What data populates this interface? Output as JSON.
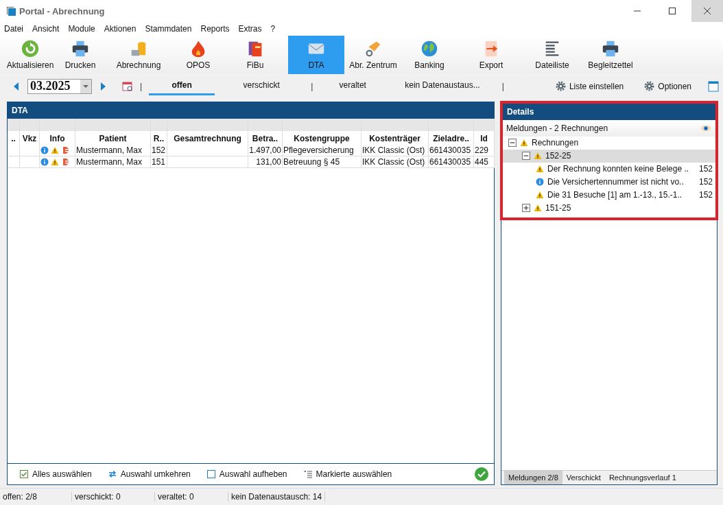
{
  "window": {
    "title": "Portal - Abrechnung"
  },
  "menu": [
    "Datei",
    "Ansicht",
    "Module",
    "Aktionen",
    "Stammdaten",
    "Reports",
    "Extras",
    "?"
  ],
  "toolbar": [
    {
      "label": "Aktualisieren",
      "selected": false
    },
    {
      "label": "Drucken",
      "selected": false
    },
    {
      "label": "Abrechnung",
      "selected": false
    },
    {
      "label": "OPOS",
      "selected": false
    },
    {
      "label": "FiBu",
      "selected": false
    },
    {
      "label": "DTA",
      "selected": true
    },
    {
      "label": "Abr. Zentrum",
      "selected": false
    },
    {
      "label": "Banking",
      "selected": false
    },
    {
      "label": "Export",
      "selected": false
    },
    {
      "label": "Dateiliste",
      "selected": false
    },
    {
      "label": "Begleitzettel",
      "selected": false
    }
  ],
  "period": {
    "value": "03.2025"
  },
  "filter_bar": [
    {
      "kind": "separator",
      "label": "|"
    },
    {
      "kind": "tab",
      "label": "offen",
      "selected": true
    },
    {
      "kind": "tab",
      "label": "verschickt",
      "selected": false
    },
    {
      "kind": "separator",
      "label": "|"
    },
    {
      "kind": "tab",
      "label": "veraltet",
      "selected": false
    },
    {
      "kind": "tab",
      "label": "kein Datenaustaus...",
      "selected": false
    },
    {
      "kind": "separator",
      "label": "|"
    }
  ],
  "actions": [
    "Liste einstellen",
    "Optionen"
  ],
  "table": {
    "title": "DTA",
    "columns": [
      "..",
      "Vkz",
      "Info",
      "Patient",
      "R..",
      "Gesamtrechnung",
      "Betra..",
      "Kostengruppe",
      "Kostenträger",
      "Zieladre..",
      "Id"
    ],
    "rows": [
      [
        "",
        "",
        "",
        "Mustermann, Max",
        "152",
        "",
        "1.497,00",
        "Pflegeversicherung",
        "IKK Classic (Ost)",
        "661430035",
        "229"
      ],
      [
        "",
        "",
        "",
        "Mustermann, Max",
        "151",
        "",
        "131,00",
        "Betreuung § 45",
        "IKK Classic (Ost)",
        "661430035",
        "445"
      ]
    ]
  },
  "bottom_actions": [
    "Alles auswählen",
    "Auswahl umkehren",
    "Auswahl aufheben",
    "Markierte auswählen"
  ],
  "details": {
    "title": "Details",
    "subtitle": "Meldungen - 2 Rechnungen",
    "tree": [
      {
        "label": "Rechnungen",
        "kind": "warning",
        "expanded": true,
        "selected": false,
        "children": [
          {
            "label": "152-25",
            "kind": "warning",
            "expanded": true,
            "selected": true,
            "children": [
              {
                "label": "Der Rechnung konnten keine Belege ..",
                "kind": "warning",
                "number": "152",
                "selected": false
              },
              {
                "label": "Die Versichertennummer ist nicht vo..",
                "kind": "info",
                "number": "152",
                "selected": false
              },
              {
                "label": "Die 31 Besuche [1] am 1.-13., 15.-1..",
                "kind": "warning",
                "number": "152",
                "selected": false
              }
            ]
          },
          {
            "label": "151-25",
            "kind": "warning",
            "expanded": false,
            "selected": false
          }
        ]
      }
    ],
    "tabs": [
      {
        "label": "Meldungen 2/8",
        "selected": true
      },
      {
        "label": "Verschickt",
        "selected": false
      },
      {
        "label": "Rechnungsverlauf 1",
        "selected": false
      }
    ]
  },
  "status_bar": [
    "offen: 2/8",
    "verschickt: 0",
    "veraltet: 0",
    "kein Datenaustausch: 14"
  ]
}
